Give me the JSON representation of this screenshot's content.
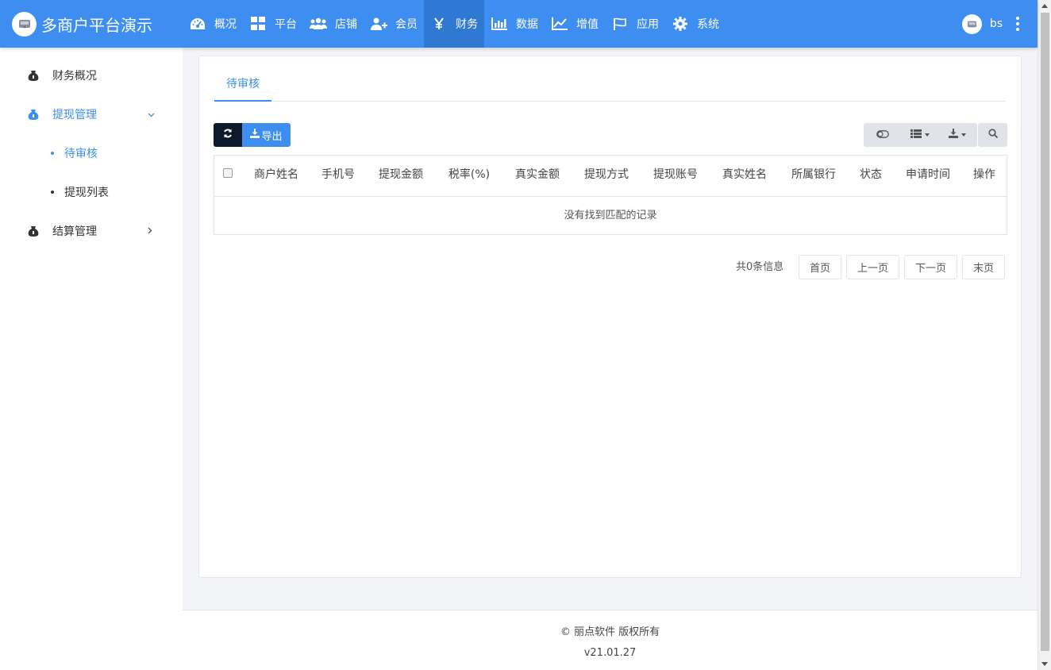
{
  "app": {
    "title": "多商户平台演示"
  },
  "nav": {
    "items": [
      {
        "label": "概况",
        "icon": "dashboard-icon"
      },
      {
        "label": "平台",
        "icon": "grid-icon"
      },
      {
        "label": "店铺",
        "icon": "users-icon"
      },
      {
        "label": "会员",
        "icon": "user-plus-icon"
      },
      {
        "label": "财务",
        "icon": "yen-icon",
        "active": true
      },
      {
        "label": "数据",
        "icon": "bar-chart-icon"
      },
      {
        "label": "增值",
        "icon": "line-chart-icon"
      },
      {
        "label": "应用",
        "icon": "flag-icon"
      },
      {
        "label": "系统",
        "icon": "gear-icon"
      }
    ]
  },
  "user": {
    "name": "bs"
  },
  "sidebar": {
    "items": [
      {
        "label": "财务概况",
        "icon": "money-bag-icon"
      },
      {
        "label": "提现管理",
        "icon": "money-bag-icon",
        "open": true
      },
      {
        "label": "结算管理",
        "icon": "money-bag-icon"
      }
    ],
    "sub_items": [
      {
        "label": "待审核",
        "active": true
      },
      {
        "label": "提现列表"
      }
    ]
  },
  "main": {
    "tabs": [
      {
        "label": "待审核"
      }
    ],
    "toolbar": {
      "export_label": "导出"
    },
    "table": {
      "columns": [
        "商户姓名",
        "手机号",
        "提现金额",
        "税率(%)",
        "真实金额",
        "提现方式",
        "提现账号",
        "真实姓名",
        "所属银行",
        "状态",
        "申请时间",
        "操作"
      ],
      "empty_text": "没有找到匹配的记录"
    },
    "pagination": {
      "info": "共0条信息",
      "first": "首页",
      "prev": "上一页",
      "next": "下一页",
      "last": "末页"
    }
  },
  "footer": {
    "copyright": "© 丽点软件 版权所有",
    "version": "v21.01.27"
  },
  "colors": {
    "primary": "#3d8ef0",
    "dark_button": "#0d1a2c"
  }
}
